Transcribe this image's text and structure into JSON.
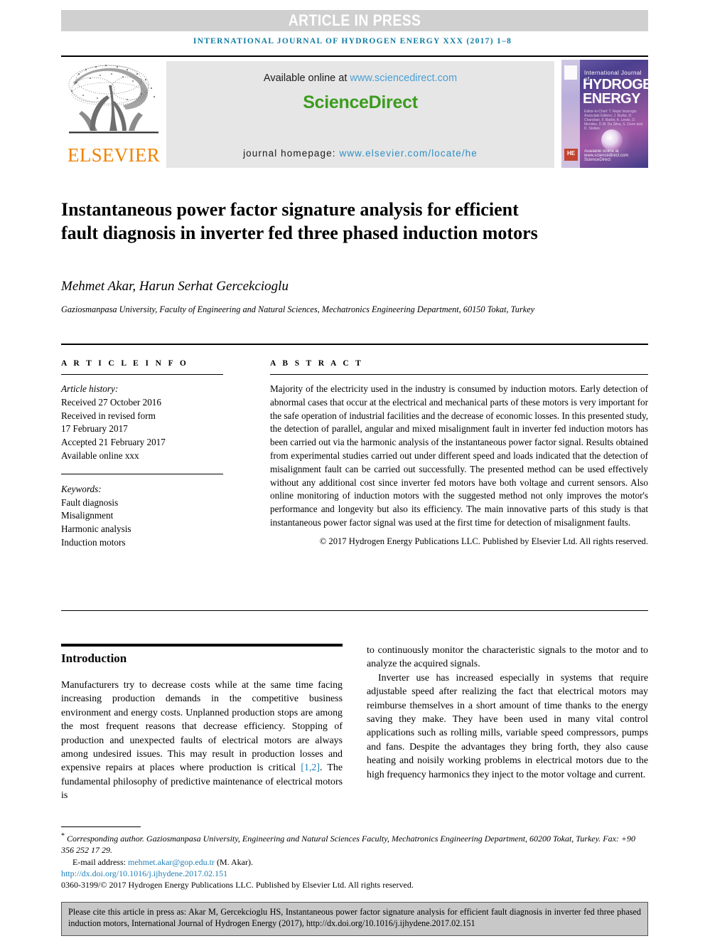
{
  "banner": {
    "article_in_press": "ARTICLE IN PRESS"
  },
  "running_head": "INTERNATIONAL JOURNAL OF HYDROGEN ENERGY XXX (2017) 1–8",
  "masthead": {
    "publisher_name": "ELSEVIER",
    "available_prefix": "Available online at ",
    "available_url": "www.sciencedirect.com",
    "sciencedirect_logo": "ScienceDirect",
    "homepage_prefix": "journal homepage: ",
    "homepage_url": "www.elsevier.com/locate/he",
    "cover": {
      "kicker": "International Journal of",
      "title_line1": "HYDROGEN",
      "title_line2": "ENERGY",
      "editors": "Editor-in-Chief: T. Nejat Veziroglu   Associate Editors: J. Burke, D. Chandran, F. Barbir, A. Lewis, D. Mendes, D.W. Da Silva, S. Dunn and D. Stolten",
      "bottom": "Available online at www.sciencedirect.com   ScienceDirect",
      "badge": "HE"
    }
  },
  "article": {
    "title": "Instantaneous power factor signature analysis for efficient fault diagnosis in inverter fed three phased induction motors",
    "authors": "Mehmet Akar, Harun Serhat Gercekcioglu",
    "author_marker": "*",
    "affiliation": "Gaziosmanpasa University, Faculty of Engineering and Natural Sciences, Mechatronics Engineering Department, 60150 Tokat, Turkey"
  },
  "info": {
    "heading": "A R T I C L E   I N F O",
    "history_label": "Article history:",
    "history": [
      "Received 27 October 2016",
      "Received in revised form",
      "17 February 2017",
      "Accepted 21 February 2017",
      "Available online xxx"
    ],
    "keywords_label": "Keywords:",
    "keywords": [
      "Fault diagnosis",
      "Misalignment",
      "Harmonic analysis",
      "Induction motors"
    ]
  },
  "abstract": {
    "heading": "A B S T R A C T",
    "text": "Majority of the electricity used in the industry is consumed by induction motors. Early detection of abnormal cases that occur at the electrical and mechanical parts of these motors is very important for the safe operation of industrial facilities and the decrease of economic losses. In this presented study, the detection of parallel, angular and mixed misalignment fault in inverter fed induction motors has been carried out via the harmonic analysis of the instantaneous power factor signal. Results obtained from experimental studies carried out under different speed and loads indicated that the detection of misalignment fault can be carried out successfully. The presented method can be used effectively without any additional cost since inverter fed motors have both voltage and current sensors. Also online monitoring of induction motors with the suggested method not only improves the motor's performance and longevity but also its efficiency. The main innovative parts of this study is that instantaneous power factor signal was used at the first time for detection of misalignment faults.",
    "copyright": "© 2017 Hydrogen Energy Publications LLC. Published by Elsevier Ltd. All rights reserved."
  },
  "body": {
    "intro_heading": "Introduction",
    "left_para1_a": "Manufacturers try to decrease costs while at the same time facing increasing production demands in the competitive business environment and energy costs. Unplanned production stops are among the most frequent reasons that decrease efficiency. Stopping of production and unexpected faults of electrical motors are always among undesired issues. This may result in production losses and expensive repairs at places where production is critical ",
    "left_ref1": "[1,2]",
    "left_para1_b": ". The fundamental philosophy of predictive maintenance of electrical motors is",
    "right_para1": "to continuously monitor the characteristic signals to the motor and to analyze the acquired signals.",
    "right_para2": "Inverter use has increased especially in systems that require adjustable speed after realizing the fact that electrical motors may reimburse themselves in a short amount of time thanks to the energy saving they make. They have been used in many vital control applications such as rolling mills, variable speed compressors, pumps and fans. Despite the advantages they bring forth, they also cause heating and noisily working problems in electrical motors due to the high frequency harmonics they inject to the motor voltage and current."
  },
  "footnote": {
    "corresponding": "Corresponding author. Gaziosmanpasa University, Engineering and Natural Sciences Faculty, Mechatronics Engineering Department, 60200 Tokat, Turkey. Fax: +90 356 252 17 29.",
    "email_label": "E-mail address: ",
    "email": "mehmet.akar@gop.edu.tr",
    "email_suffix": " (M. Akar).",
    "doi": "http://dx.doi.org/10.1016/j.ijhydene.2017.02.151",
    "issn_line": "0360-3199/© 2017 Hydrogen Energy Publications LLC. Published by Elsevier Ltd. All rights reserved."
  },
  "citation_box": {
    "text": "Please cite this article in press as: Akar M, Gercekcioglu HS, Instantaneous power factor signature analysis for efficient fault diagnosis in inverter fed three phased induction motors, International Journal of Hydrogen Energy (2017), http://dx.doi.org/10.1016/j.ijhydene.2017.02.151"
  },
  "colors": {
    "journal_teal": "#0f7ca3",
    "elsevier_orange": "#ef8200",
    "sciencedirect_green": "#3b9c1e",
    "link_blue": "#2e8fc4",
    "banner_gray": "#d0d0d0",
    "cite_box_gray": "#c8c8c8"
  }
}
